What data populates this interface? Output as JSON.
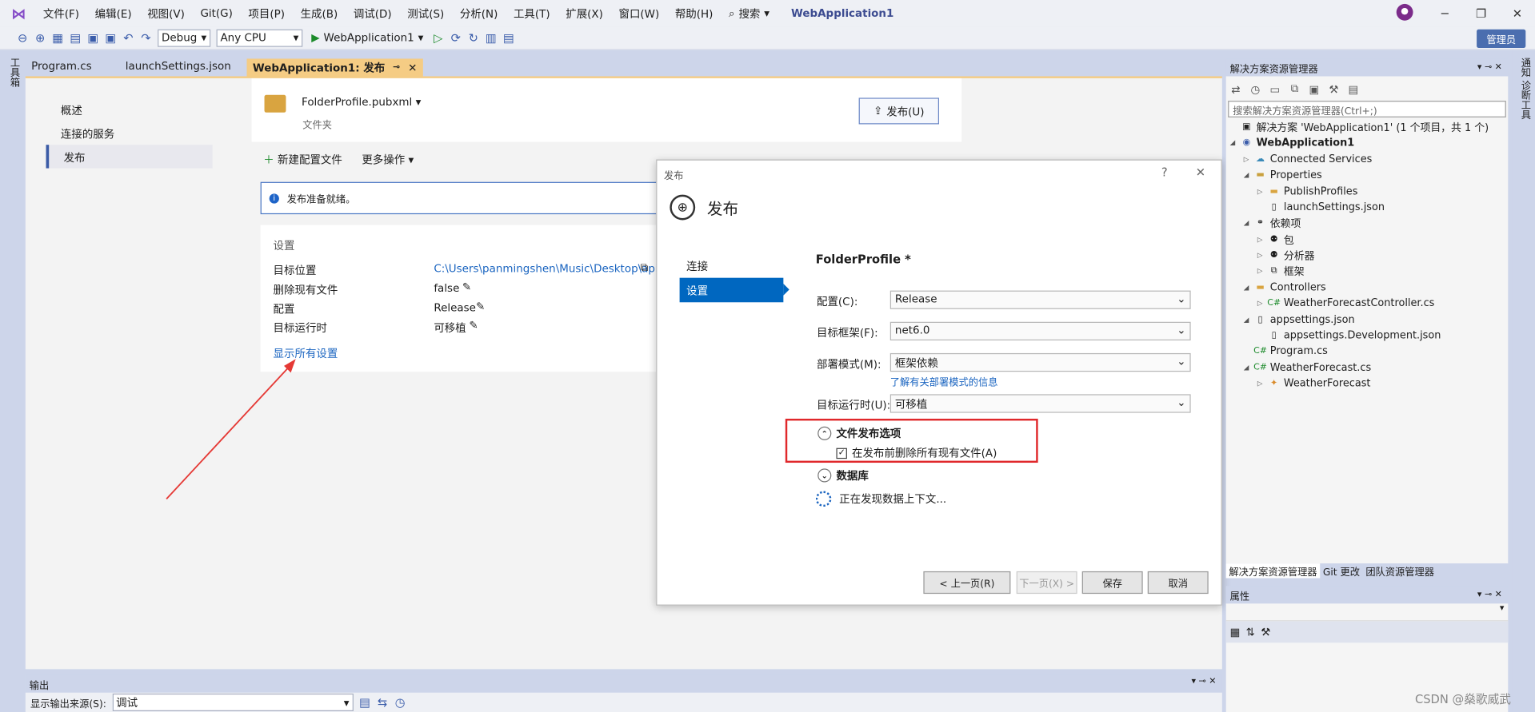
{
  "menu": {
    "items": [
      "文件(F)",
      "编辑(E)",
      "视图(V)",
      "Git(G)",
      "项目(P)",
      "生成(B)",
      "调试(D)",
      "测试(S)",
      "分析(N)",
      "工具(T)",
      "扩展(X)",
      "窗口(W)",
      "帮助(H)"
    ],
    "search": "搜索",
    "app_title": "WebApplication1"
  },
  "toolbar": {
    "config": "Debug",
    "platform": "Any CPU",
    "run_label": "WebApplication1",
    "manage": "管理员"
  },
  "side": {
    "left": "工具箱",
    "right": "通知  诊断工具"
  },
  "tabs": [
    "Program.cs",
    "launchSettings.json",
    "WebApplication1: 发布"
  ],
  "publish": {
    "nav": [
      "概述",
      "连接的服务",
      "发布"
    ],
    "profile": "FolderProfile.pubxml",
    "profile_sub": "文件夹",
    "publish_btn": "发布(U)",
    "new_profile": "新建配置文件",
    "more_actions": "更多操作",
    "ready": "发布准备就绪。",
    "settings_title": "设置",
    "settings": [
      {
        "label": "目标位置",
        "value": "C:\\Users\\panmingshen\\Music\\Desktop\\api"
      },
      {
        "label": "删除现有文件",
        "value": "false"
      },
      {
        "label": "配置",
        "value": "Release"
      },
      {
        "label": "目标运行时",
        "value": "可移植"
      }
    ],
    "show_all": "显示所有设置"
  },
  "dialog": {
    "title": "发布",
    "header": "发布",
    "help": "?",
    "close": "✕",
    "nav": [
      "连接",
      "设置"
    ],
    "profile_title": "FolderProfile *",
    "fields": [
      {
        "label": "配置(C):",
        "value": "Release"
      },
      {
        "label": "目标框架(F):",
        "value": "net6.0"
      },
      {
        "label": "部署模式(M):",
        "value": "框架依赖"
      },
      {
        "label": "目标运行时(U):",
        "value": "可移植"
      }
    ],
    "deploy_link": "了解有关部署模式的信息",
    "file_options": "文件发布选项",
    "delete_existing": "在发布前删除所有现有文件(A)",
    "database": "数据库",
    "discovering": "正在发现数据上下文...",
    "buttons": [
      "< 上一页(R)",
      "下一页(X) >",
      "保存",
      "取消"
    ]
  },
  "solution": {
    "title": "解决方案资源管理器",
    "search_placeholder": "搜索解决方案资源管理器(Ctrl+;)",
    "nodes": [
      "解决方案 'WebApplication1' (1 个项目，共 1 个)",
      "WebApplication1",
      "Connected Services",
      "Properties",
      "PublishProfiles",
      "launchSettings.json",
      "依赖项",
      "包",
      "分析器",
      "框架",
      "Controllers",
      "WeatherForecastController.cs",
      "appsettings.json",
      "appsettings.Development.json",
      "Program.cs",
      "WeatherForecast.cs",
      "WeatherForecast"
    ],
    "bottom_tabs": [
      "解决方案资源管理器",
      "Git 更改",
      "团队资源管理器"
    ],
    "props_title": "属性"
  },
  "output": {
    "title": "输出",
    "source_label": "显示输出来源(S):",
    "source": "调试"
  },
  "watermark": "CSDN @燊歌威武"
}
